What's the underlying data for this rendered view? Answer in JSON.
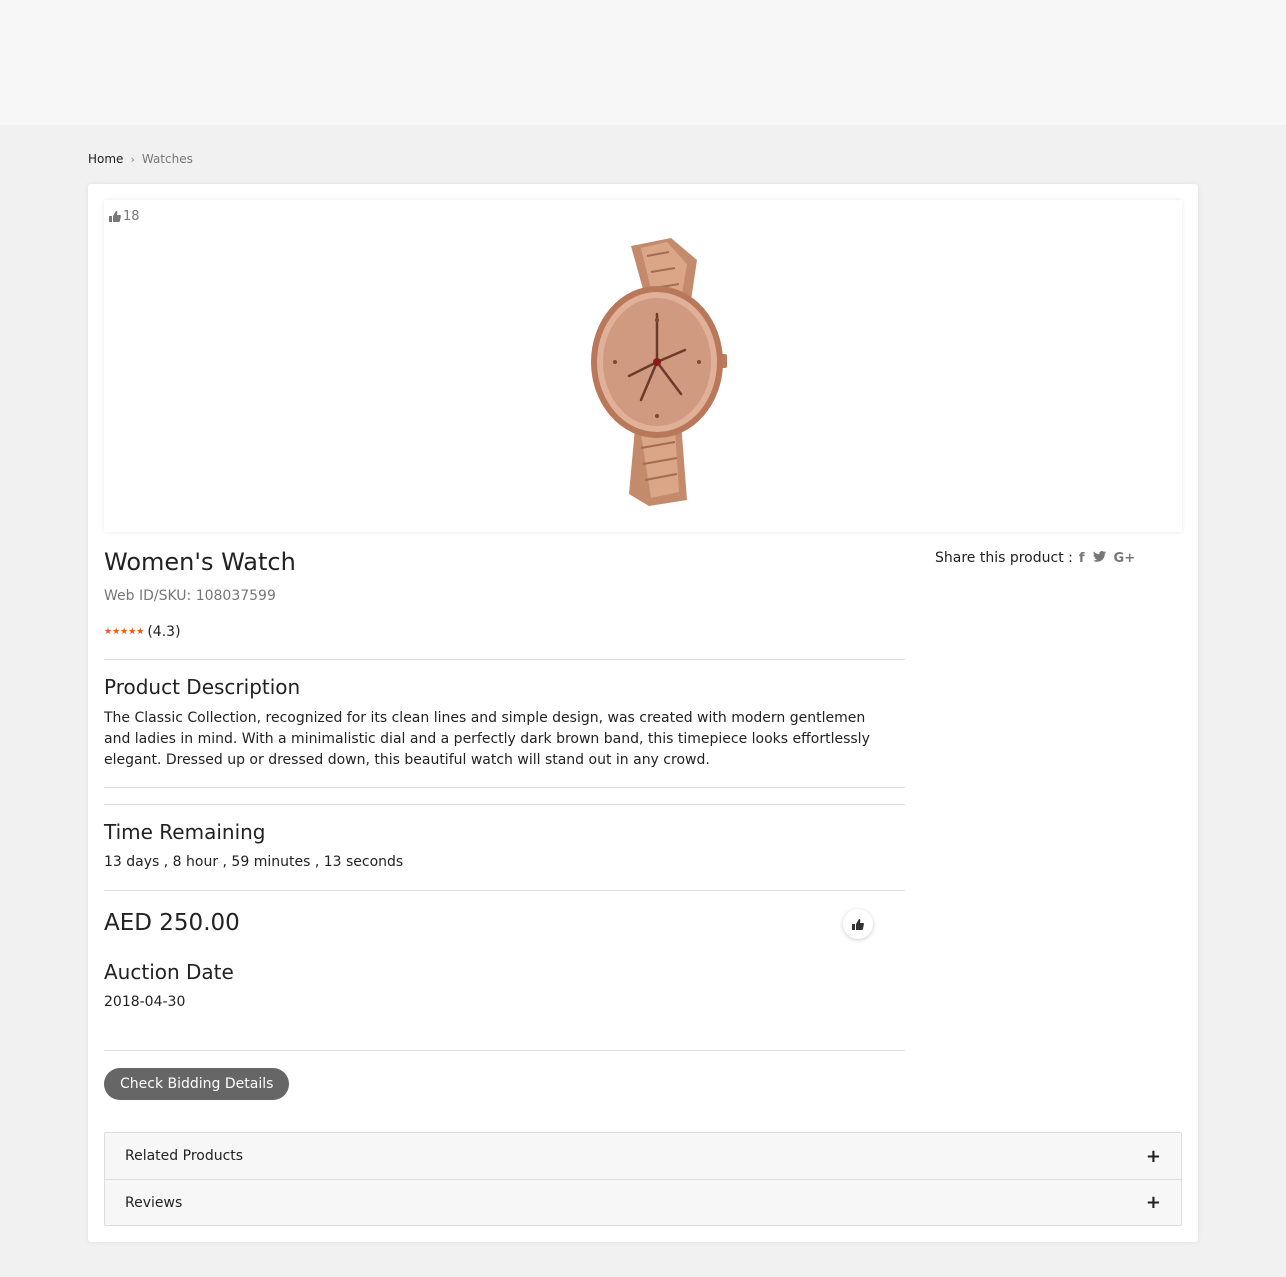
{
  "breadcrumb": {
    "home": "Home",
    "separator": "›",
    "current": "Watches"
  },
  "product": {
    "likes": "18",
    "title": "Women's Watch",
    "sku": "Web ID/SKU: 108037599",
    "stars": "★★★★★",
    "rating": "(4.3)",
    "rating_value": 4.3
  },
  "share": {
    "label": "Share this product :",
    "facebook": "f",
    "twitter": "t",
    "google": "G+"
  },
  "description": {
    "heading": "Product Description",
    "text": "The Classic Collection, recognized for its clean lines and simple design, was created with modern gentlemen and ladies in mind. With a minimalistic dial and a perfectly dark brown band, this timepiece looks effortlessly elegant. Dressed up or dressed down, this beautiful watch will stand out in any crowd."
  },
  "time_remaining": {
    "heading": "Time Remaining",
    "value": "13 days , 8 hour , 59 minutes , 13 seconds"
  },
  "price": "AED 250.00",
  "auction": {
    "heading": "Auction Date",
    "date": "2018-04-30"
  },
  "bid_button": "Check Bidding Details",
  "accordion": [
    {
      "label": "Related Products",
      "icon": "+"
    },
    {
      "label": "Reviews",
      "icon": "+"
    }
  ],
  "colors": {
    "accent_star": "#e8571c",
    "button_bg": "#666666",
    "page_bg": "#f1f1f1"
  }
}
